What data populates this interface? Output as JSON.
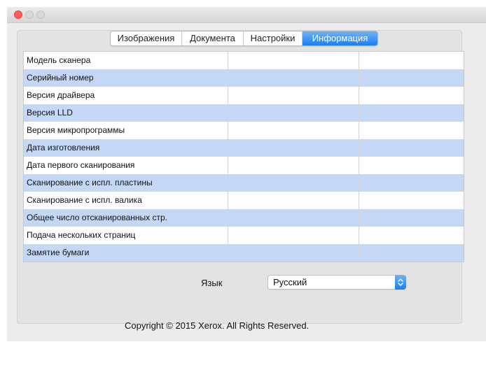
{
  "tabs": [
    {
      "label": "Изображения",
      "active": false
    },
    {
      "label": "Документа",
      "active": false
    },
    {
      "label": "Настройки",
      "active": false
    },
    {
      "label": "Информация",
      "active": true
    }
  ],
  "info_rows": [
    {
      "label": "Модель сканера",
      "value": "",
      "extra": ""
    },
    {
      "label": "Серийный номер",
      "value": "",
      "extra": ""
    },
    {
      "label": "Версия драйвера",
      "value": "",
      "extra": ""
    },
    {
      "label": "Версия LLD",
      "value": "",
      "extra": ""
    },
    {
      "label": "Версия микропрограммы",
      "value": "",
      "extra": ""
    },
    {
      "label": "Дата изготовления",
      "value": "",
      "extra": ""
    },
    {
      "label": "Дата первого сканирования",
      "value": "",
      "extra": ""
    },
    {
      "label": "Сканирование с испл. пластины",
      "value": "",
      "extra": ""
    },
    {
      "label": "Сканирование с испл. валика",
      "value": "",
      "extra": ""
    },
    {
      "label": "Общее число отсканированных стр.",
      "value": "",
      "extra": ""
    },
    {
      "label": "Подача нескольких страниц",
      "value": "",
      "extra": ""
    },
    {
      "label": "Замятие бумаги",
      "value": "",
      "extra": ""
    }
  ],
  "language": {
    "label": "Язык",
    "selected": "Русский"
  },
  "copyright": "Copyright © 2015 Xerox. All Rights Reserved.",
  "colors": {
    "accent": "#1a7ff0",
    "stripe": "#c4d7f6",
    "close": "#fc5f57"
  }
}
